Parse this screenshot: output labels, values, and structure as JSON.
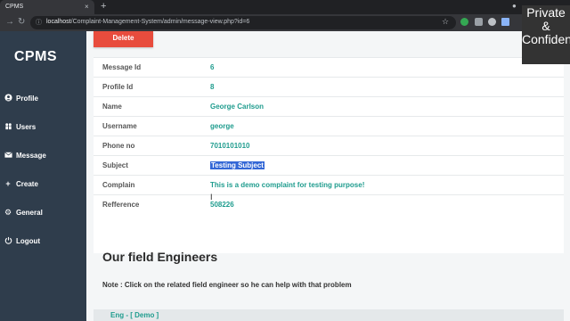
{
  "browser": {
    "tab_title": "CPMS",
    "tab_close": "×",
    "new_tab": "+",
    "url_host": "localhost",
    "url_path": "/Complaint-Management-System/admin/message-view.php?id=6"
  },
  "overlay": {
    "watermark": "Private & Confidential"
  },
  "sidebar": {
    "brand": "CPMS",
    "items": [
      {
        "label": "Profile",
        "icon": "user-icon"
      },
      {
        "label": "Users",
        "icon": "users-icon"
      },
      {
        "label": "Message",
        "icon": "envelope-icon"
      },
      {
        "label": "Create",
        "icon": "plus-icon"
      },
      {
        "label": "General",
        "icon": "gear-icon"
      },
      {
        "label": "Logout",
        "icon": "power-icon"
      }
    ]
  },
  "main": {
    "delete_label": "Delete",
    "rows": [
      {
        "label": "Message Id",
        "value": "6"
      },
      {
        "label": "Profile Id",
        "value": "8"
      },
      {
        "label": "Name",
        "value": "George Carlson"
      },
      {
        "label": "Username",
        "value": "george"
      },
      {
        "label": "Phone no",
        "value": "7010101010"
      },
      {
        "label": "Subject",
        "value": "Testing Subject"
      },
      {
        "label": "Complain",
        "value": "This is a demo complaint for testing purpose!"
      },
      {
        "label": "Refference",
        "value": "508226"
      }
    ],
    "section_title": "Our field Engineers",
    "note": "Note : Click on the related field engineer so he can help with that problem",
    "engineer_link": "Eng - [ Demo ]"
  },
  "colors": {
    "sidebar": "#2f3d4c",
    "accent": "#1f9c8e",
    "delete": "#e84c3d"
  }
}
